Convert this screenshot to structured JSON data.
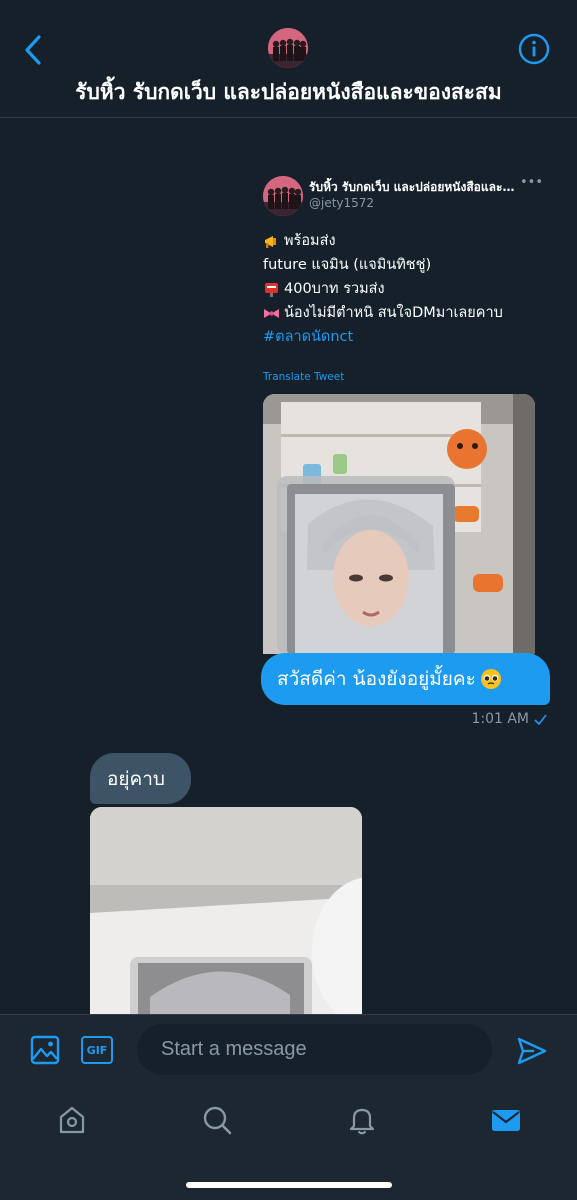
{
  "header": {
    "title": "รับหิ้ว รับกดเว็บ และปล่อยหนังสือและของสะสม",
    "back_icon": "chevron-left-icon",
    "info_icon": "info-icon"
  },
  "shared_tweet": {
    "display_name": "รับหิ้ว รับกดเว็บ และปล่อยหนังสือและของ...",
    "handle": "@jety1572",
    "lines": [
      {
        "emoji": "megaphone-icon",
        "text": "พร้อมส่ง"
      },
      {
        "emoji": "",
        "text": "future แจมิน (แจมินทิชชู่)"
      },
      {
        "emoji": "postbox-icon",
        "text": "400บาท รวมส่ง"
      },
      {
        "emoji": "ribbon-icon",
        "text": "น้องไม่มีตำหนิ  สนใจDMมาเลยคาบ"
      }
    ],
    "hashtag": "#ตลาดนัดnct",
    "translate_label": "Translate Tweet"
  },
  "messages": {
    "sent": {
      "text": "สวัสดีค่า น้องยังอยู่มั้ยคะ",
      "emoji": "pleading-face-icon",
      "time": "1:01 AM"
    },
    "received": {
      "text": "อยุ่คาบ"
    }
  },
  "composer": {
    "placeholder": "Start a message",
    "gif_label": "GIF"
  },
  "colors": {
    "background": "#15202b",
    "accent": "#1d9bf0",
    "received_bubble": "#3d5466",
    "muted_text": "#8899a6"
  },
  "tabs": [
    "home-icon",
    "search-icon",
    "notifications-icon",
    "messages-icon"
  ]
}
